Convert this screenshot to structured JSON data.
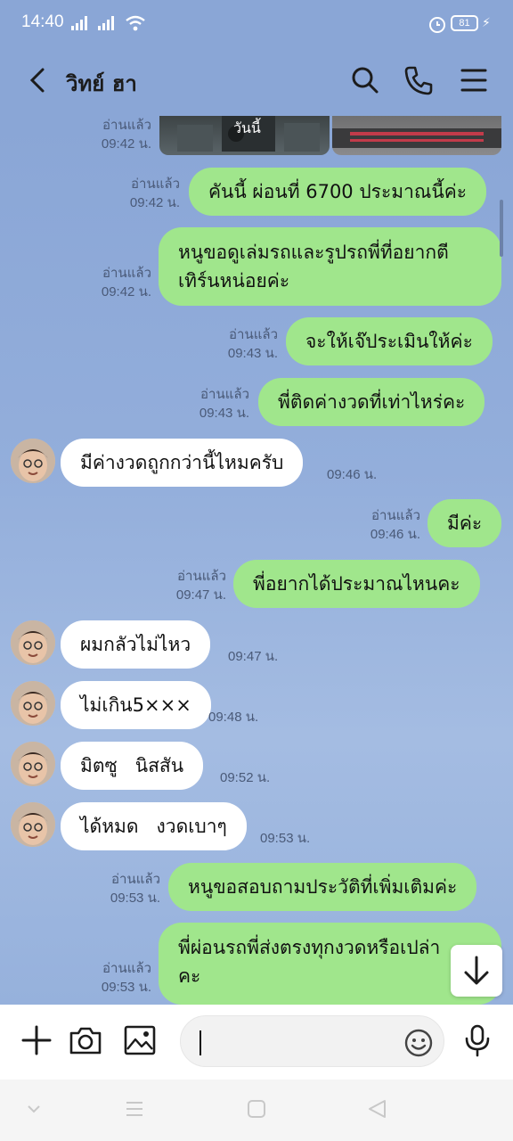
{
  "status_bar": {
    "time": "14:40",
    "battery": "81"
  },
  "header": {
    "contact_name": "วิทย์ ฮา"
  },
  "day_label": "วันนี้",
  "messages": [
    {
      "dir": "out",
      "type": "image",
      "read": "อ่านแล้ว",
      "time": "09:42 น."
    },
    {
      "dir": "out",
      "text": "คันนี้ ผ่อนที่ 6700 ประมาณนี้ค่ะ",
      "read": "อ่านแล้ว",
      "time": "09:42 น."
    },
    {
      "dir": "out",
      "lines": [
        "หนูขอดูเล่มรถและรูปรถพี่ที่อยากตี",
        "เทิร์นหน่อยค่ะ"
      ],
      "read": "อ่านแล้ว",
      "time": "09:42 น."
    },
    {
      "dir": "out",
      "text": "จะให้เจ๊ประเมินให้ค่ะ",
      "read": "อ่านแล้ว",
      "time": "09:43 น."
    },
    {
      "dir": "out",
      "text": "พี่ติดค่างวดที่เท่าไหร่คะ",
      "read": "อ่านแล้ว",
      "time": "09:43 น."
    },
    {
      "dir": "in",
      "text": "มีค่างวดถูกกว่านี้ไหมครับ",
      "time": "09:46 น."
    },
    {
      "dir": "out",
      "text": "มีค่ะ",
      "read": "อ่านแล้ว",
      "time": "09:46 น."
    },
    {
      "dir": "out",
      "text": "พี่อยากได้ประมาณไหนคะ",
      "read": "อ่านแล้ว",
      "time": "09:47 น."
    },
    {
      "dir": "in",
      "text": "ผมกลัวไม่ไหว",
      "time": "09:47 น."
    },
    {
      "dir": "in",
      "text": "ไม่เกิน5×××",
      "time": "09:48 น."
    },
    {
      "dir": "in",
      "text": "มิตซู   นิสสัน",
      "time": "09:52 น."
    },
    {
      "dir": "in",
      "text": "ได้หมด   งวดเบาๆ",
      "time": "09:53 น."
    },
    {
      "dir": "out",
      "text": "หนูขอสอบถามประวัติที่เพิ่มเติมค่ะ",
      "read": "อ่านแล้ว",
      "time": "09:53 น."
    },
    {
      "dir": "out",
      "lines": [
        "พี่ผ่อนรถพี่ส่งตรงทุกงวดหรือเปล่า",
        "คะ"
      ],
      "read": "อ่านแล้ว",
      "time": "09:53 น."
    }
  ],
  "input": {
    "placeholder": ""
  },
  "icons": {
    "back": "chevron-left-icon",
    "search": "search-icon",
    "call": "phone-icon",
    "menu": "menu-icon",
    "add": "plus-icon",
    "camera": "camera-icon",
    "gallery": "image-icon",
    "emoji": "emoji-icon",
    "mic": "microphone-icon",
    "scroll_down": "arrow-down-icon"
  },
  "colors": {
    "background": "#8aa6d6",
    "outgoing_bubble": "#a0e68c",
    "incoming_bubble": "#ffffff",
    "meta_text": "#4a5a78"
  }
}
